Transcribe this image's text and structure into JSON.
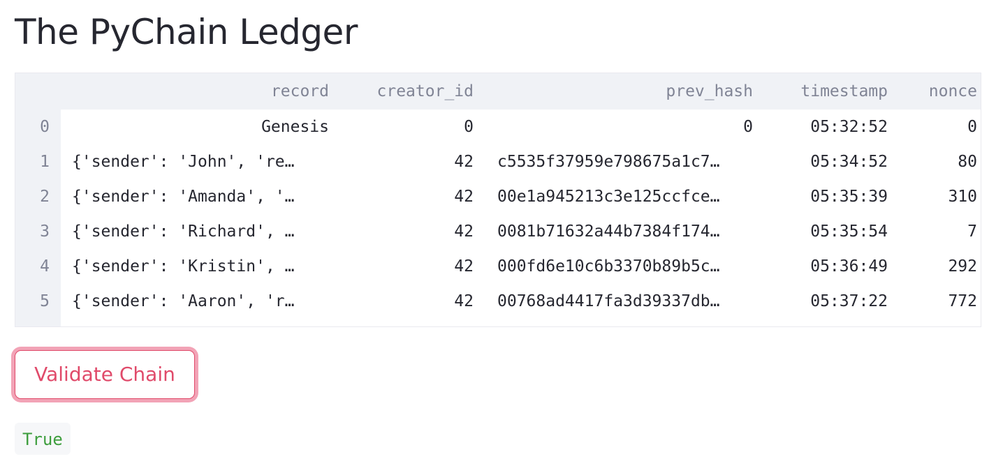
{
  "page": {
    "title": "The PyChain Ledger"
  },
  "table": {
    "columns": [
      "record",
      "creator_id",
      "prev_hash",
      "timestamp",
      "nonce"
    ],
    "rows": [
      {
        "index": "0",
        "record": "Genesis",
        "creator_id": "0",
        "prev_hash": "0",
        "timestamp": "05:32:52",
        "nonce": "0"
      },
      {
        "index": "1",
        "record": "{'sender': 'John', 're…",
        "creator_id": "42",
        "prev_hash": "c5535f37959e798675a1c7…",
        "timestamp": "05:34:52",
        "nonce": "80"
      },
      {
        "index": "2",
        "record": "{'sender': 'Amanda', '…",
        "creator_id": "42",
        "prev_hash": "00e1a945213c3e125ccfce…",
        "timestamp": "05:35:39",
        "nonce": "310"
      },
      {
        "index": "3",
        "record": "{'sender': 'Richard', …",
        "creator_id": "42",
        "prev_hash": "0081b71632a44b7384f174…",
        "timestamp": "05:35:54",
        "nonce": "7"
      },
      {
        "index": "4",
        "record": "{'sender': 'Kristin', …",
        "creator_id": "42",
        "prev_hash": "000fd6e10c6b3370b89b5c…",
        "timestamp": "05:36:49",
        "nonce": "292"
      },
      {
        "index": "5",
        "record": "{'sender': 'Aaron', 'r…",
        "creator_id": "42",
        "prev_hash": "00768ad4417fa3d39337db…",
        "timestamp": "05:37:22",
        "nonce": "772"
      }
    ]
  },
  "actions": {
    "validate_label": "Validate Chain"
  },
  "result": {
    "value": "True"
  },
  "colors": {
    "accent": "#e04a6a",
    "success_text": "#3e9e3e",
    "header_bg": "#f0f2f6",
    "muted_text": "#808495"
  }
}
